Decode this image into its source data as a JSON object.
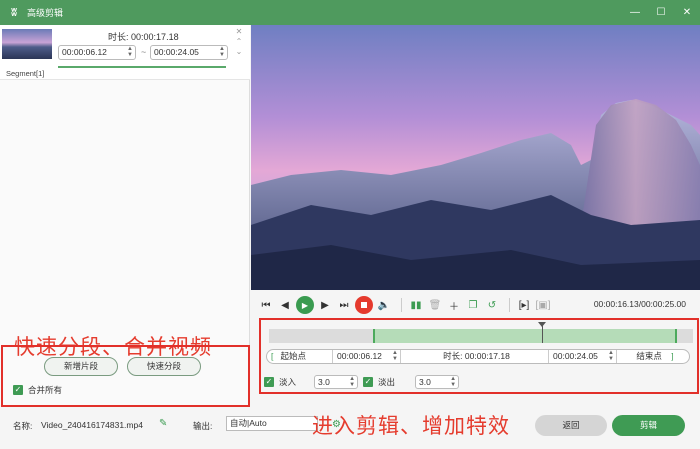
{
  "window": {
    "title": "高级剪辑",
    "logo": "ʬ"
  },
  "segment": {
    "duration_label": "时长:",
    "duration_value": "00:00:17.18",
    "start_time": "00:00:06.12",
    "end_time": "00:00:24.05",
    "tilde": "~",
    "name": "Segment[1]"
  },
  "left_panel": {
    "promo_text": "快速分段、合并视频",
    "new_segment_label": "新增片段",
    "quick_split_label": "快速分段",
    "merge_all_label": "合并所有"
  },
  "player": {
    "timecode": "00:00:16.13/00:00:25.00"
  },
  "editor": {
    "start_point_label": "起始点",
    "start_value": "00:00:06.12",
    "duration_label": "时长:",
    "duration_value": "00:00:17.18",
    "end_value": "00:00:24.05",
    "end_point_label": "结束点",
    "fade_in_label": "淡入",
    "fade_in_value": "3.0",
    "fade_out_label": "淡出",
    "fade_out_value": "3.0",
    "selection_start_fraction": 0.245,
    "selection_end_fraction": 0.962,
    "playhead_fraction": 0.645
  },
  "bottom": {
    "name_label": "名称:",
    "filename": "Video_240416174831.mp4",
    "output_label": "输出:",
    "output_value": "自动|Auto",
    "promo_text": "进入剪辑、增加特效",
    "back_label": "返回",
    "clip_label": "剪辑"
  },
  "colors": {
    "accent": "#4f9a5e",
    "promo": "#e53c2e",
    "highlight_border": "#e2302a"
  }
}
